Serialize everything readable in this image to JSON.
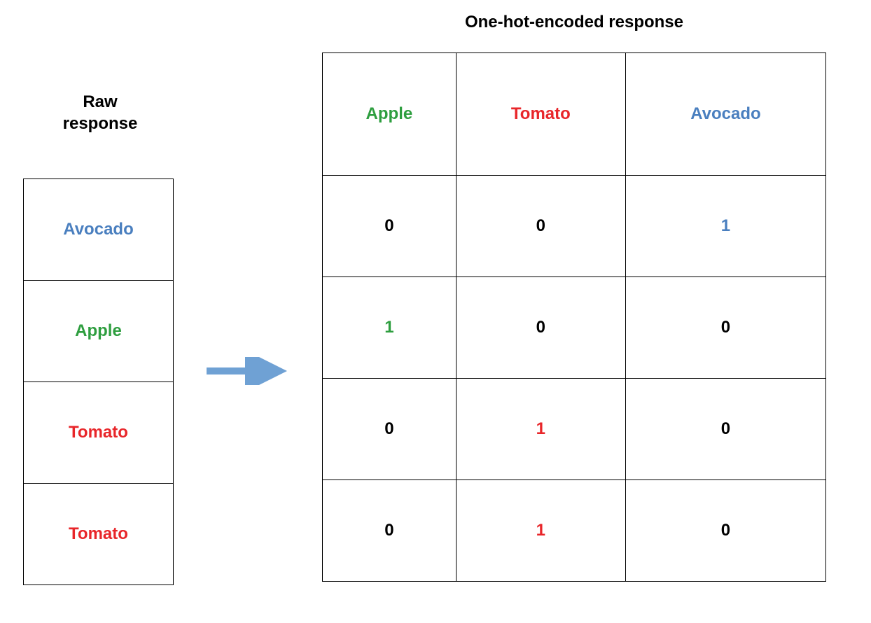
{
  "colors": {
    "apple": "#2E9E3F",
    "tomato": "#E8262A",
    "avocado": "#4A7FBF",
    "black": "#000000",
    "arrow": "#6FA1D4"
  },
  "raw": {
    "title_line1": "Raw",
    "title_line2": "response",
    "items": [
      {
        "label": "Avocado",
        "colorKey": "avocado"
      },
      {
        "label": "Apple",
        "colorKey": "apple"
      },
      {
        "label": "Tomato",
        "colorKey": "tomato"
      },
      {
        "label": "Tomato",
        "colorKey": "tomato"
      }
    ]
  },
  "encoded": {
    "title": "One-hot-encoded response",
    "headers": [
      {
        "label": "Apple",
        "colorKey": "apple"
      },
      {
        "label": "Tomato",
        "colorKey": "tomato"
      },
      {
        "label": "Avocado",
        "colorKey": "avocado"
      }
    ],
    "rows": [
      [
        {
          "value": "0",
          "colorKey": "black"
        },
        {
          "value": "0",
          "colorKey": "black"
        },
        {
          "value": "1",
          "colorKey": "avocado"
        }
      ],
      [
        {
          "value": "1",
          "colorKey": "apple"
        },
        {
          "value": "0",
          "colorKey": "black"
        },
        {
          "value": "0",
          "colorKey": "black"
        }
      ],
      [
        {
          "value": "0",
          "colorKey": "black"
        },
        {
          "value": "1",
          "colorKey": "tomato"
        },
        {
          "value": "0",
          "colorKey": "black"
        }
      ],
      [
        {
          "value": "0",
          "colorKey": "black"
        },
        {
          "value": "1",
          "colorKey": "tomato"
        },
        {
          "value": "0",
          "colorKey": "black"
        }
      ]
    ]
  }
}
